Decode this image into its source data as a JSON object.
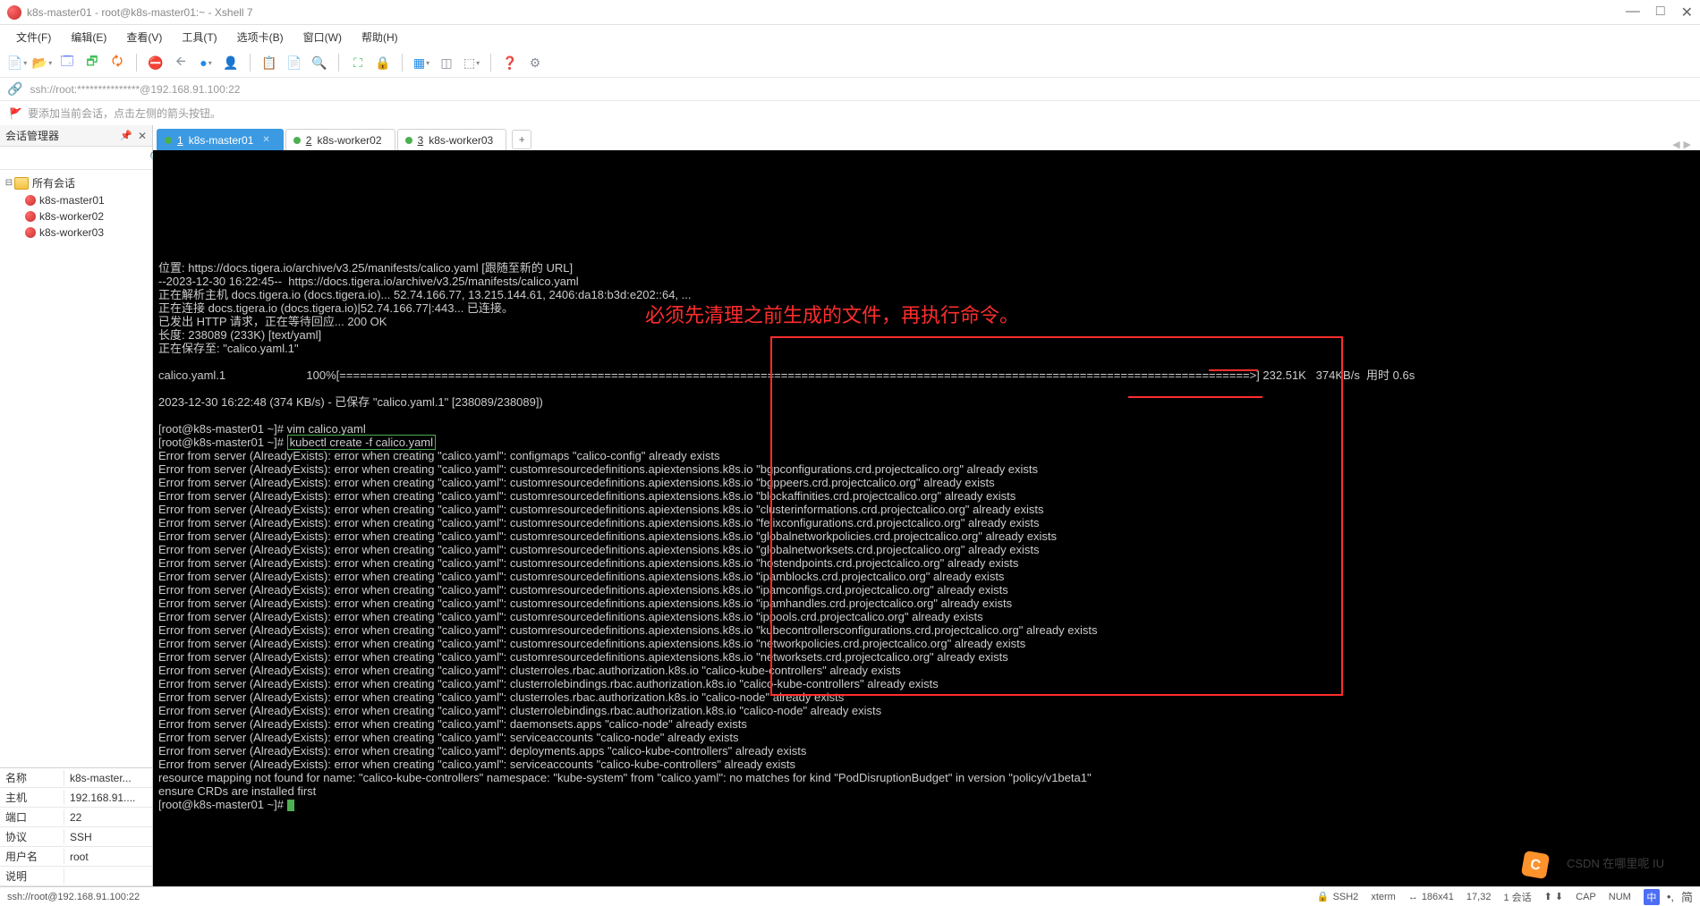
{
  "window": {
    "title": "k8s-master01 - root@k8s-master01:~ - Xshell 7",
    "controls": {
      "min": "—",
      "max": "□",
      "close": "✕"
    }
  },
  "menu": {
    "file": "文件(F)",
    "edit": "编辑(E)",
    "view": "查看(V)",
    "tools": "工具(T)",
    "tab": "选项卡(B)",
    "window": "窗口(W)",
    "help": "帮助(H)"
  },
  "address": {
    "url": "ssh://root:***************@192.168.91.100:22"
  },
  "tipbar": {
    "text": "要添加当前会话，点击左侧的箭头按钮。"
  },
  "sidebar": {
    "title": "会话管理器",
    "root": "所有会话",
    "items": [
      {
        "label": "k8s-master01"
      },
      {
        "label": "k8s-worker02"
      },
      {
        "label": "k8s-worker03"
      }
    ]
  },
  "props": {
    "rows": [
      {
        "k": "名称",
        "v": "k8s-master..."
      },
      {
        "k": "主机",
        "v": "192.168.91...."
      },
      {
        "k": "端口",
        "v": "22"
      },
      {
        "k": "协议",
        "v": "SSH"
      },
      {
        "k": "用户名",
        "v": "root"
      },
      {
        "k": "说明",
        "v": ""
      }
    ]
  },
  "tabs": {
    "items": [
      {
        "num": "1",
        "label": "k8s-master01",
        "active": true
      },
      {
        "num": "2",
        "label": "k8s-worker02",
        "active": false
      },
      {
        "num": "3",
        "label": "k8s-worker03",
        "active": false
      }
    ],
    "add": "+"
  },
  "terminal": {
    "lines_pre": [
      "位置: https://docs.tigera.io/archive/v3.25/manifests/calico.yaml [跟随至新的 URL]",
      "--2023-12-30 16:22:45--  https://docs.tigera.io/archive/v3.25/manifests/calico.yaml",
      "正在解析主机 docs.tigera.io (docs.tigera.io)... 52.74.166.77, 13.215.144.61, 2406:da18:b3d:e202::64, ...",
      "正在连接 docs.tigera.io (docs.tigera.io)|52.74.166.77|:443... 已连接。",
      "已发出 HTTP 请求，正在等待回应... 200 OK",
      "长度: 238089 (233K) [text/yaml]",
      "正在保存至: \"calico.yaml.1\"",
      "",
      "calico.yaml.1                         100%[======================================================================================================================================>] 232.51K   374KB/s  用时 0.6s",
      "",
      "2023-12-30 16:22:48 (374 KB/s) - 已保存 \"calico.yaml.1\" [238089/238089])",
      ""
    ],
    "prompt1": "[root@k8s-master01 ~]# ",
    "cmd1": "vim calico.yaml",
    "prompt2": "[root@k8s-master01 ~]# ",
    "cmd2": "kubectl create -f calico.yaml",
    "lines_err": [
      "Error from server (AlreadyExists): error when creating \"calico.yaml\": configmaps \"calico-config\" already exists",
      "Error from server (AlreadyExists): error when creating \"calico.yaml\": customresourcedefinitions.apiextensions.k8s.io \"bgpconfigurations.crd.projectcalico.org\" already exists",
      "Error from server (AlreadyExists): error when creating \"calico.yaml\": customresourcedefinitions.apiextensions.k8s.io \"bgppeers.crd.projectcalico.org\" already exists",
      "Error from server (AlreadyExists): error when creating \"calico.yaml\": customresourcedefinitions.apiextensions.k8s.io \"blockaffinities.crd.projectcalico.org\" already exists",
      "Error from server (AlreadyExists): error when creating \"calico.yaml\": customresourcedefinitions.apiextensions.k8s.io \"clusterinformations.crd.projectcalico.org\" already exists",
      "Error from server (AlreadyExists): error when creating \"calico.yaml\": customresourcedefinitions.apiextensions.k8s.io \"felixconfigurations.crd.projectcalico.org\" already exists",
      "Error from server (AlreadyExists): error when creating \"calico.yaml\": customresourcedefinitions.apiextensions.k8s.io \"globalnetworkpolicies.crd.projectcalico.org\" already exists",
      "Error from server (AlreadyExists): error when creating \"calico.yaml\": customresourcedefinitions.apiextensions.k8s.io \"globalnetworksets.crd.projectcalico.org\" already exists",
      "Error from server (AlreadyExists): error when creating \"calico.yaml\": customresourcedefinitions.apiextensions.k8s.io \"hostendpoints.crd.projectcalico.org\" already exists",
      "Error from server (AlreadyExists): error when creating \"calico.yaml\": customresourcedefinitions.apiextensions.k8s.io \"ipamblocks.crd.projectcalico.org\" already exists",
      "Error from server (AlreadyExists): error when creating \"calico.yaml\": customresourcedefinitions.apiextensions.k8s.io \"ipamconfigs.crd.projectcalico.org\" already exists",
      "Error from server (AlreadyExists): error when creating \"calico.yaml\": customresourcedefinitions.apiextensions.k8s.io \"ipamhandles.crd.projectcalico.org\" already exists",
      "Error from server (AlreadyExists): error when creating \"calico.yaml\": customresourcedefinitions.apiextensions.k8s.io \"ippools.crd.projectcalico.org\" already exists",
      "Error from server (AlreadyExists): error when creating \"calico.yaml\": customresourcedefinitions.apiextensions.k8s.io \"kubecontrollersconfigurations.crd.projectcalico.org\" already exists",
      "Error from server (AlreadyExists): error when creating \"calico.yaml\": customresourcedefinitions.apiextensions.k8s.io \"networkpolicies.crd.projectcalico.org\" already exists",
      "Error from server (AlreadyExists): error when creating \"calico.yaml\": customresourcedefinitions.apiextensions.k8s.io \"networksets.crd.projectcalico.org\" already exists",
      "Error from server (AlreadyExists): error when creating \"calico.yaml\": clusterroles.rbac.authorization.k8s.io \"calico-kube-controllers\" already exists",
      "Error from server (AlreadyExists): error when creating \"calico.yaml\": clusterrolebindings.rbac.authorization.k8s.io \"calico-kube-controllers\" already exists",
      "Error from server (AlreadyExists): error when creating \"calico.yaml\": clusterroles.rbac.authorization.k8s.io \"calico-node\" already exists",
      "Error from server (AlreadyExists): error when creating \"calico.yaml\": clusterrolebindings.rbac.authorization.k8s.io \"calico-node\" already exists",
      "Error from server (AlreadyExists): error when creating \"calico.yaml\": daemonsets.apps \"calico-node\" already exists",
      "Error from server (AlreadyExists): error when creating \"calico.yaml\": serviceaccounts \"calico-node\" already exists",
      "Error from server (AlreadyExists): error when creating \"calico.yaml\": deployments.apps \"calico-kube-controllers\" already exists",
      "Error from server (AlreadyExists): error when creating \"calico.yaml\": serviceaccounts \"calico-kube-controllers\" already exists",
      "resource mapping not found for name: \"calico-kube-controllers\" namespace: \"kube-system\" from \"calico.yaml\": no matches for kind \"PodDisruptionBudget\" in version \"policy/v1beta1\"",
      "ensure CRDs are installed first"
    ],
    "prompt3": "[root@k8s-master01 ~]# ",
    "annotation": "必须先清理之前生成的文件，再执行命令。",
    "watermark": "CSDN 在哪里呢 IU"
  },
  "statusbar": {
    "left": "ssh://root@192.168.91.100:22",
    "ssh2": "SSH2",
    "term": "xterm",
    "size": "186x41",
    "cursor": "17,32",
    "sess": "1 会话",
    "cap": "CAP",
    "num": "NUM",
    "ime": {
      "zhong": "中",
      "symbol": "•,",
      "jian": "简"
    }
  }
}
